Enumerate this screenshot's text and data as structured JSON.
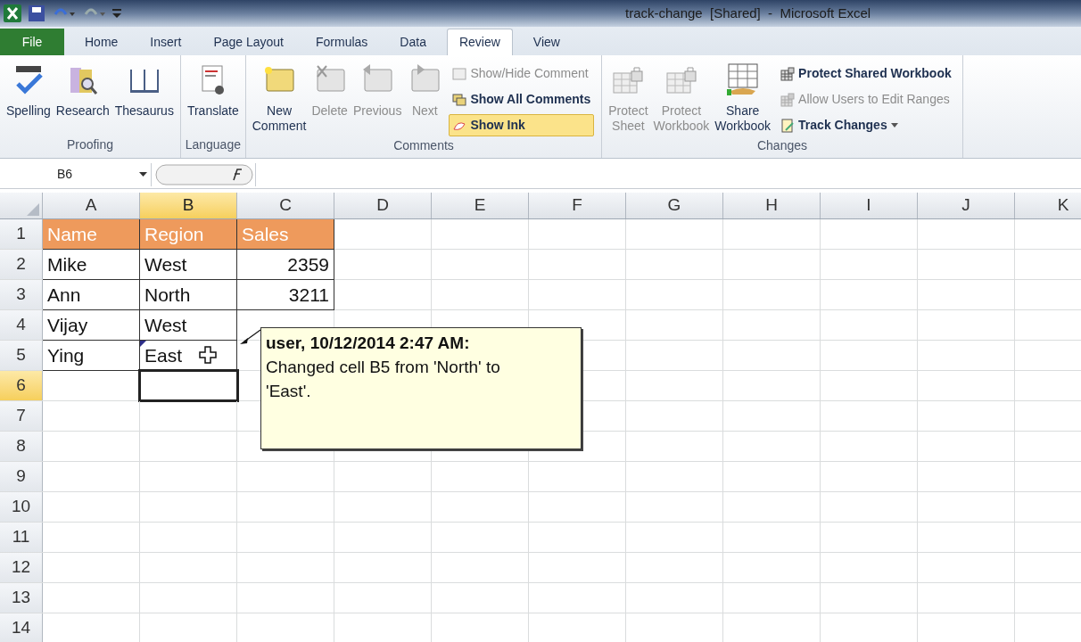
{
  "window": {
    "title": "track-change  [Shared]  -  Microsoft Excel"
  },
  "tabs": [
    {
      "label": "File",
      "kind": "file",
      "selected": false
    },
    {
      "label": "Home",
      "kind": "tab",
      "selected": false
    },
    {
      "label": "Insert",
      "kind": "tab",
      "selected": false
    },
    {
      "label": "Page Layout",
      "kind": "tab",
      "selected": false
    },
    {
      "label": "Formulas",
      "kind": "tab",
      "selected": false
    },
    {
      "label": "Data",
      "kind": "tab",
      "selected": false
    },
    {
      "label": "Review",
      "kind": "tab",
      "selected": true
    },
    {
      "label": "View",
      "kind": "tab",
      "selected": false
    }
  ],
  "ribbon": [
    {
      "label": "Proofing",
      "items": [
        {
          "kind": "large",
          "label": "Spelling",
          "disabled": false
        },
        {
          "kind": "large",
          "label": "Research",
          "disabled": false
        },
        {
          "kind": "large",
          "label": "Thesaurus",
          "disabled": false
        }
      ]
    },
    {
      "label": "Language",
      "items": [
        {
          "kind": "large",
          "label": "Translate",
          "disabled": false
        }
      ]
    },
    {
      "label": "Comments",
      "items": [
        {
          "kind": "large",
          "label": "New Comment",
          "disabled": false
        },
        {
          "kind": "large",
          "label": "Delete",
          "disabled": true
        },
        {
          "kind": "large",
          "label": "Previous",
          "disabled": true
        },
        {
          "kind": "large",
          "label": "Next",
          "disabled": true
        },
        {
          "kind": "stack",
          "items": [
            {
              "label": "Show/Hide Comment",
              "disabled": true,
              "on": false
            },
            {
              "label": "Show All Comments",
              "disabled": false,
              "on": false
            },
            {
              "label": "Show Ink",
              "disabled": false,
              "on": true
            }
          ]
        }
      ]
    },
    {
      "label": "Changes",
      "items": [
        {
          "kind": "large",
          "label": "Protect Sheet",
          "disabled": true
        },
        {
          "kind": "large",
          "label": "Protect Workbook",
          "disabled": true
        },
        {
          "kind": "large",
          "label": "Share Workbook",
          "disabled": false
        },
        {
          "kind": "stack",
          "items": [
            {
              "label": "Protect Shared Workbook",
              "disabled": false,
              "on": false
            },
            {
              "label": "Allow Users to Edit Ranges",
              "disabled": true,
              "on": false
            },
            {
              "label": "Track Changes",
              "disabled": false,
              "on": false,
              "dropdown": true
            }
          ]
        }
      ]
    }
  ],
  "formula_bar": {
    "name_box": "B6"
  },
  "columns": [
    {
      "label": "A",
      "selected": false
    },
    {
      "label": "B",
      "selected": true
    },
    {
      "label": "C",
      "selected": false
    },
    {
      "label": "D",
      "selected": false
    },
    {
      "label": "E",
      "selected": false
    },
    {
      "label": "F",
      "selected": false
    },
    {
      "label": "G",
      "selected": false
    },
    {
      "label": "H",
      "selected": false
    },
    {
      "label": "I",
      "selected": false
    },
    {
      "label": "J",
      "selected": false
    },
    {
      "label": "K",
      "selected": false
    }
  ],
  "rows": [
    {
      "label": "1",
      "selected": false,
      "kind": "header",
      "cells": [
        {
          "text": "Name"
        },
        {
          "text": "Region"
        },
        {
          "text": "Sales"
        }
      ]
    },
    {
      "label": "2",
      "selected": false,
      "kind": "data",
      "cells": [
        {
          "text": "Mike"
        },
        {
          "text": "West"
        },
        {
          "text": "2359"
        }
      ]
    },
    {
      "label": "3",
      "selected": false,
      "kind": "data",
      "cells": [
        {
          "text": "Ann"
        },
        {
          "text": "North"
        },
        {
          "text": "3211"
        }
      ]
    },
    {
      "label": "4",
      "selected": false,
      "kind": "data",
      "cells": [
        {
          "text": "Vijay"
        },
        {
          "text": "West"
        }
      ]
    },
    {
      "label": "5",
      "selected": false,
      "kind": "data",
      "cells": [
        {
          "text": "Ying"
        },
        {
          "text": "East",
          "tracked": true
        }
      ]
    },
    {
      "label": "6",
      "selected": true,
      "kind": "data",
      "cells": [
        {},
        {
          "active": true
        }
      ]
    },
    {
      "label": "7",
      "selected": false,
      "kind": "data",
      "cells": []
    },
    {
      "label": "8",
      "selected": false,
      "kind": "data",
      "cells": []
    },
    {
      "label": "9",
      "selected": false,
      "kind": "data",
      "cells": []
    },
    {
      "label": "10",
      "selected": false,
      "kind": "data",
      "cells": []
    },
    {
      "label": "11",
      "selected": false,
      "kind": "data",
      "cells": []
    },
    {
      "label": "12",
      "selected": false,
      "kind": "data",
      "cells": []
    },
    {
      "label": "13",
      "selected": false,
      "kind": "data",
      "cells": []
    },
    {
      "label": "14",
      "selected": false,
      "kind": "data",
      "cells": []
    }
  ],
  "comment": {
    "author": "user, 10/12/2014 2:47 AM:",
    "text": "Changed cell B5 from 'North' to 'East'."
  }
}
